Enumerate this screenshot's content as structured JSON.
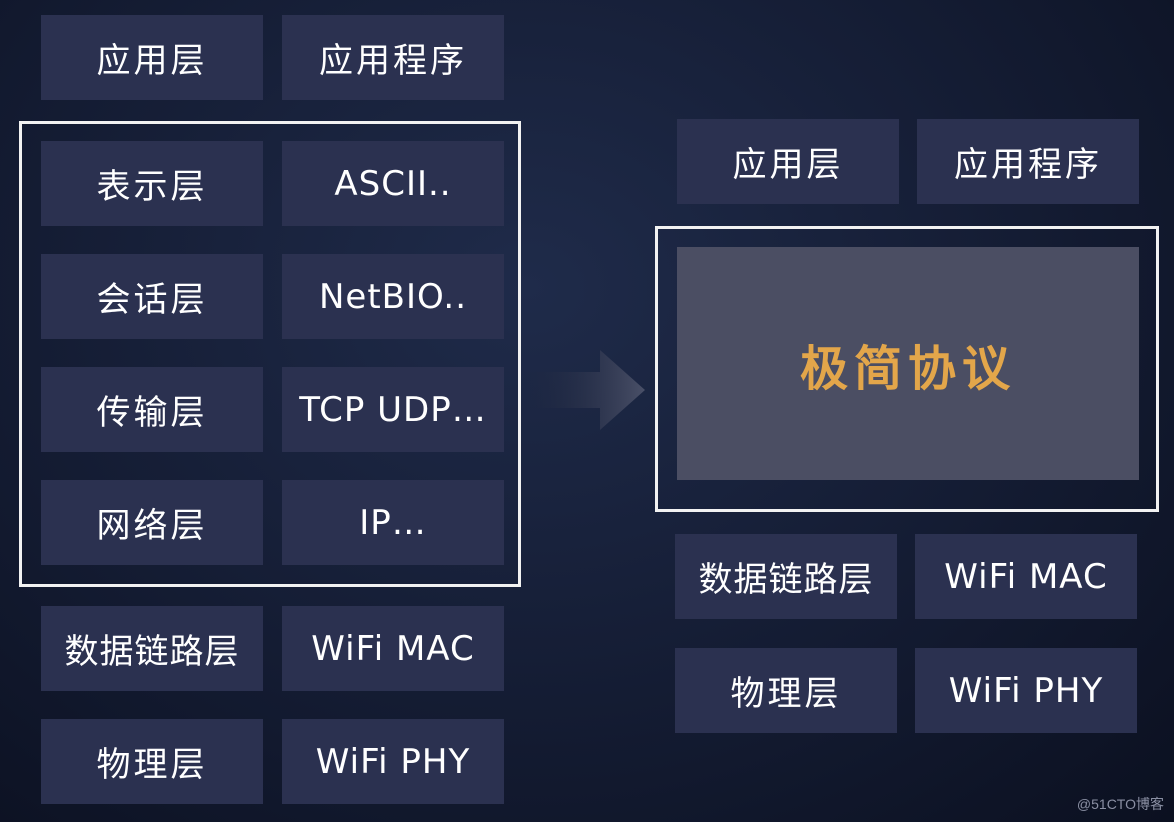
{
  "left_stack": {
    "rows": [
      {
        "layer": "应用层",
        "example": "应用程序"
      },
      {
        "layer": "表示层",
        "example": "ASCII.."
      },
      {
        "layer": "会话层",
        "example": "NetBIO.."
      },
      {
        "layer": "传输层",
        "example": "TCP UDP…"
      },
      {
        "layer": "网络层",
        "example": "IP…"
      },
      {
        "layer": "数据链路层",
        "example": "WiFi MAC"
      },
      {
        "layer": "物理层",
        "example": "WiFi PHY"
      }
    ]
  },
  "right_stack": {
    "rows": [
      {
        "layer": "应用层",
        "example": "应用程序"
      },
      {
        "layer": "数据链路层",
        "example": "WiFi MAC"
      },
      {
        "layer": "物理层",
        "example": "WiFi PHY"
      }
    ],
    "center_label": "极简协议"
  },
  "watermark": "@51CTO博客",
  "colors": {
    "cell_bg": "#2b3150",
    "highlight_text": "#e3a64a",
    "frame": "#f2f2f2"
  }
}
